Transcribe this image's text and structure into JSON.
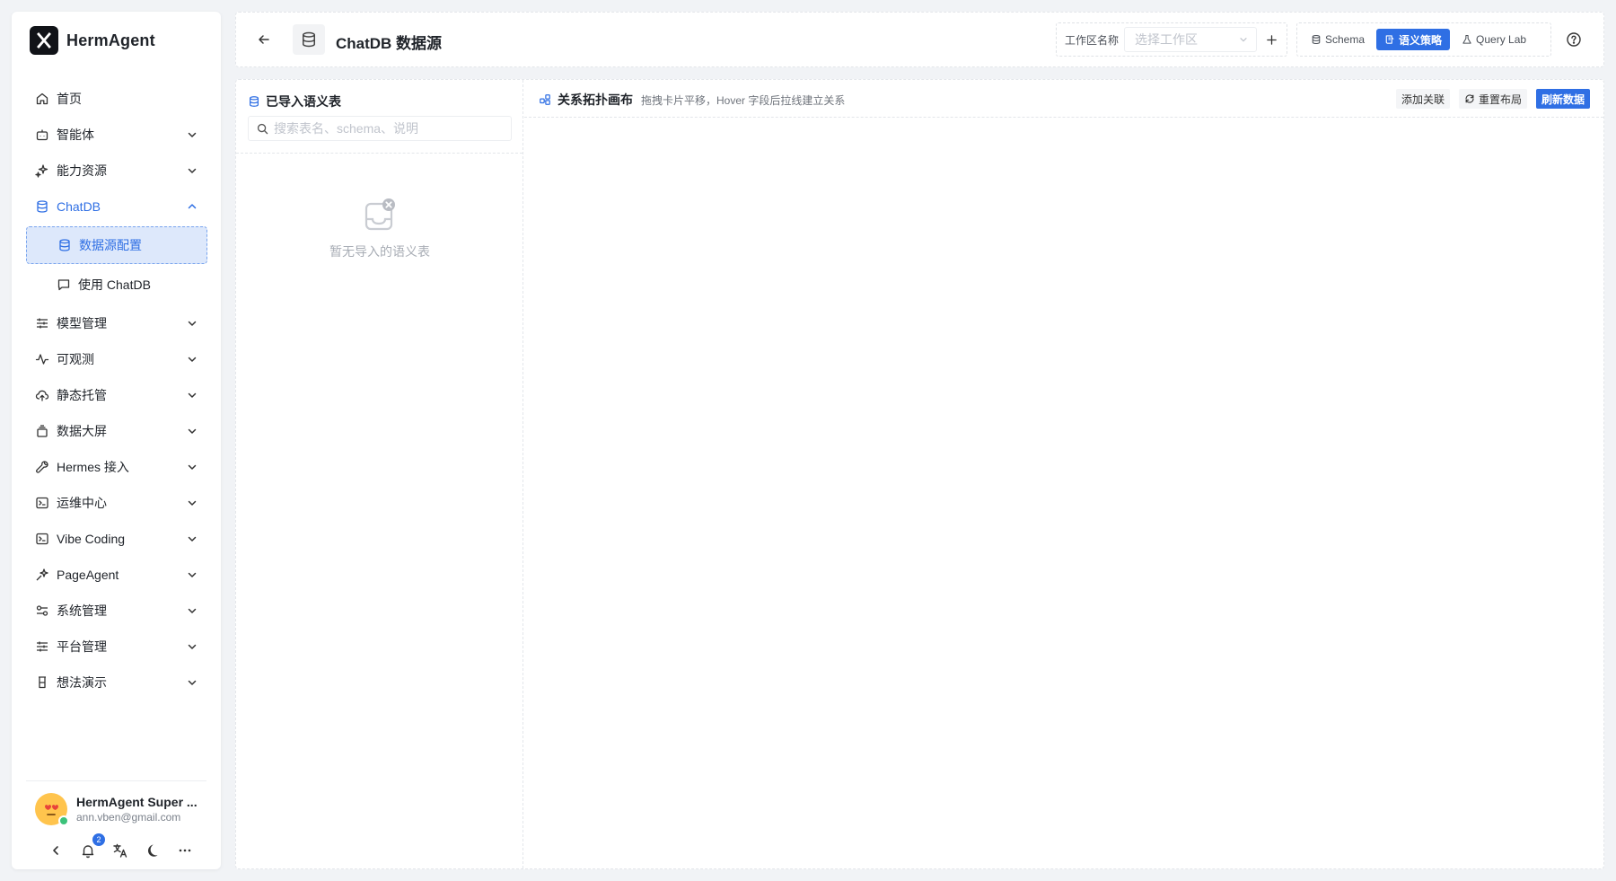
{
  "brand": {
    "name": "HermAgent",
    "logo_glyph": "X"
  },
  "sidebar": {
    "items": [
      {
        "label": "首页",
        "icon": "home-icon",
        "arrow": ""
      },
      {
        "label": "智能体",
        "icon": "robot-icon",
        "arrow": "chevron-down-icon"
      },
      {
        "label": "能力资源",
        "icon": "sparkles-icon",
        "arrow": "chevron-down-icon"
      },
      {
        "label": "ChatDB",
        "icon": "database-icon",
        "arrow": "chevron-up-icon",
        "active": true
      },
      {
        "label": "数据源配置",
        "icon": "database-icon",
        "sub": true,
        "selected": true
      },
      {
        "label": "使用 ChatDB",
        "icon": "chat-icon",
        "sub": true
      },
      {
        "label": "模型管理",
        "icon": "sliders-icon",
        "arrow": "chevron-down-icon"
      },
      {
        "label": "可观测",
        "icon": "activity-icon",
        "arrow": "chevron-down-icon"
      },
      {
        "label": "静态托管",
        "icon": "cloud-upload-icon",
        "arrow": "chevron-down-icon"
      },
      {
        "label": "数据大屏",
        "icon": "layers-icon",
        "arrow": "chevron-down-icon"
      },
      {
        "label": "Hermes 接入",
        "icon": "wrench-icon",
        "arrow": "chevron-down-icon"
      },
      {
        "label": "运维中心",
        "icon": "terminal-icon",
        "arrow": "chevron-down-icon"
      },
      {
        "label": "Vibe Coding",
        "icon": "terminal-icon",
        "arrow": "chevron-down-icon"
      },
      {
        "label": "PageAgent",
        "icon": "sparkles-icon",
        "arrow": "chevron-down-icon"
      },
      {
        "label": "系统管理",
        "icon": "toggles-icon",
        "arrow": "chevron-down-icon"
      },
      {
        "label": "平台管理",
        "icon": "sliders-icon",
        "arrow": "chevron-down-icon"
      },
      {
        "label": "想法演示",
        "icon": "flask-icon",
        "arrow": "chevron-down-icon"
      }
    ]
  },
  "user": {
    "name": "HermAgent Super ...",
    "email": "ann.vben@gmail.com"
  },
  "notifications": {
    "count": "2"
  },
  "header": {
    "title": "ChatDB 数据源",
    "workspace_label": "工作区名称",
    "workspace_placeholder": "选择工作区",
    "tabs": [
      {
        "label": "Schema",
        "icon": "database-icon",
        "active": false
      },
      {
        "label": "语义策略",
        "icon": "book-icon",
        "active": true
      },
      {
        "label": "Query Lab",
        "icon": "flask-icon",
        "active": false
      }
    ]
  },
  "left_panel": {
    "title": "已导入语义表",
    "search_placeholder": "搜索表名、schema、说明",
    "empty_text": "暂无导入的语义表"
  },
  "canvas": {
    "title": "关系拓扑画布",
    "hint": "拖拽卡片平移，Hover 字段后拉线建立关系",
    "add_relation": "添加关联",
    "reset_layout": "重置布局",
    "refresh": "刷新数据"
  },
  "colors": {
    "accent": "#2f6fe4",
    "selected_bg": "#dde8fb",
    "page_bg": "#f1f3f6"
  }
}
